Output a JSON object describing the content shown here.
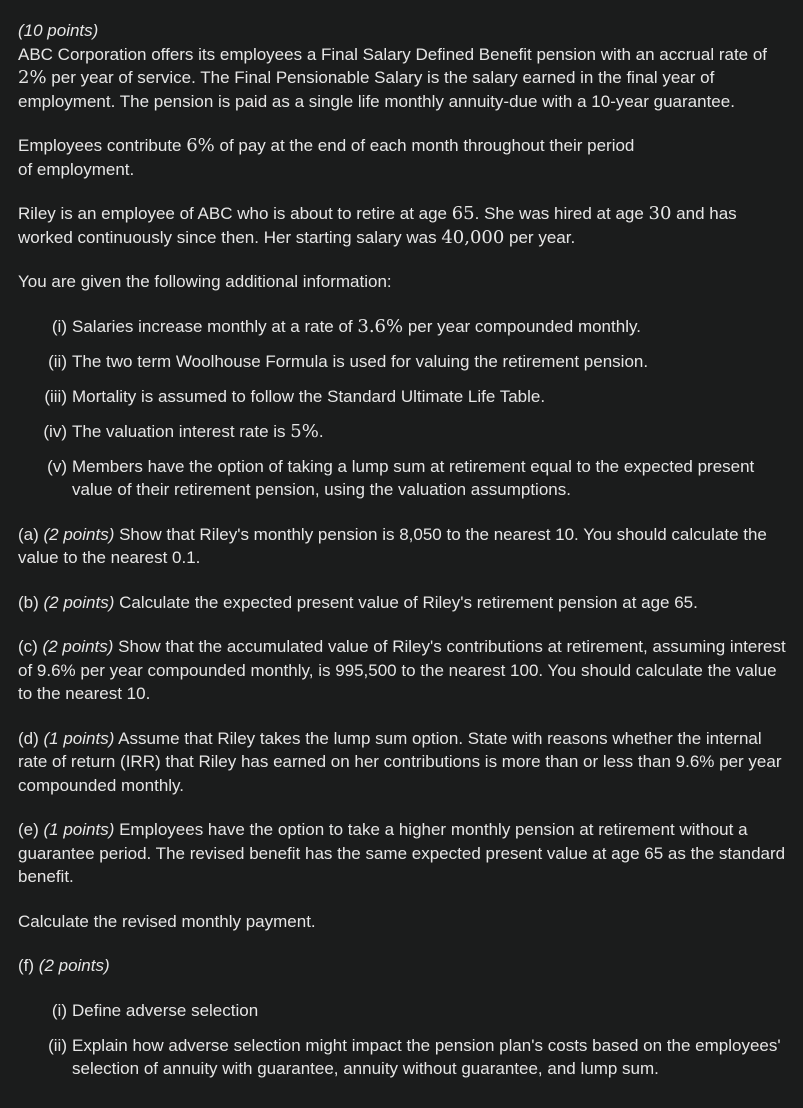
{
  "intro": {
    "points": "(10 points)",
    "p1_a": "ABC Corporation offers its employees a Final Salary Defined Benefit pension with an accrual rate of ",
    "p1_rate": "2%",
    "p1_b": " per year of service. The Final Pensionable Salary is the salary earned in the final year of employment. The pension is paid as a single life monthly annuity-due with a 10-year guarantee.",
    "p2_a": "Employees contribute ",
    "p2_rate": "6%",
    "p2_b": " of pay at the end of each month throughout their period",
    "p2_c": "of employment.",
    "p3_a": "Riley is an employee of ABC who is about to retire at age ",
    "p3_age": "65",
    "p3_b": ". She was hired at age ",
    "p3_hire": "30",
    "p3_c": " and has worked continuously since then. Her starting salary was ",
    "p3_salary": "40,000",
    "p3_d": " per year.",
    "p4": "You are given the following additional information:"
  },
  "info": [
    {
      "num": "(i)",
      "a": "Salaries increase monthly at a rate of ",
      "m": "3.6%",
      "b": " per year compounded monthly."
    },
    {
      "num": "(ii)",
      "a": "The two term Woolhouse Formula is used for valuing the retirement pension.",
      "m": "",
      "b": ""
    },
    {
      "num": "(iii)",
      "a": "Mortality is assumed to follow the Standard Ultimate Life Table.",
      "m": "",
      "b": ""
    },
    {
      "num": "(iv)",
      "a": "The valuation interest rate is ",
      "m": "5%",
      "b": "."
    },
    {
      "num": "(v)",
      "a": "Members have the option of taking a lump sum at retirement equal to the expected present value of their retirement pension, using the valuation assumptions.",
      "m": "",
      "b": ""
    }
  ],
  "parts": {
    "a": {
      "label": "(a) ",
      "pts": "(2 points)",
      "text": " Show that Riley's monthly pension is 8,050 to the nearest 10. You should calculate the value to the nearest 0.1."
    },
    "b": {
      "label": "(b) ",
      "pts": "(2 points)",
      "text": " Calculate the expected present value of Riley's retirement pension at age 65."
    },
    "c": {
      "label": "(c) ",
      "pts": "(2 points)",
      "text": " Show that the accumulated value of Riley's contributions at retirement, assuming interest of 9.6% per year compounded monthly, is 995,500 to the nearest 100. You should calculate the value to the nearest 10."
    },
    "d": {
      "label": "(d) ",
      "pts": "(1 points)",
      "text": " Assume that Riley takes the lump sum option. State with reasons whether the internal rate of return (IRR) that Riley has earned on her contributions is more than or less than 9.6% per year compounded monthly."
    },
    "e": {
      "label": "(e) ",
      "pts": "(1 points)",
      "text": " Employees have the option to take a higher monthly pension at retirement without a guarantee period. The revised benefit has the same expected present value at age 65 as the standard benefit."
    },
    "e_calc": "Calculate the revised monthly payment.",
    "f": {
      "label": "(f) ",
      "pts": "(2 points)"
    },
    "f_items": [
      {
        "num": "(i)",
        "text": "Define adverse selection"
      },
      {
        "num": "(ii)",
        "text": "Explain how adverse selection might impact the pension plan's costs based on the employees' selection of annuity with guarantee, annuity without guarantee, and lump sum."
      }
    ]
  }
}
